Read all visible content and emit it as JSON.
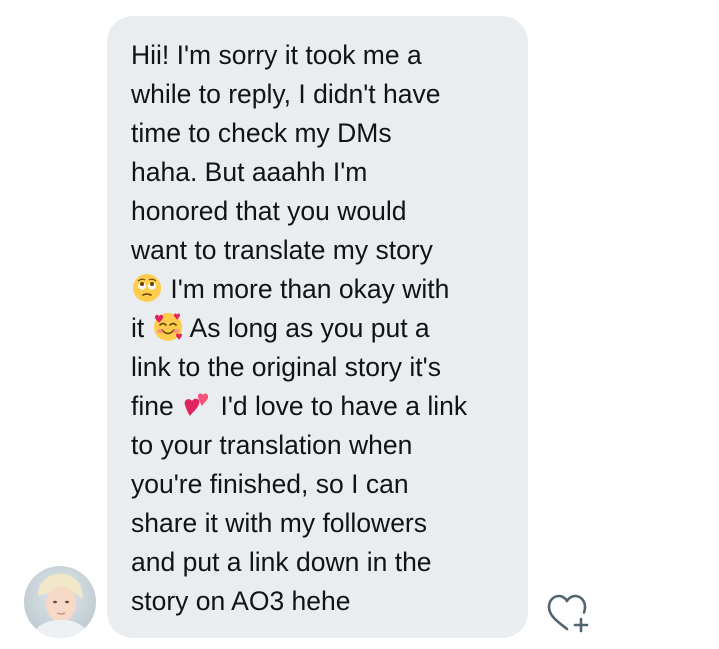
{
  "message": {
    "lines": [
      "Hii! I'm sorry it took me a",
      "while to reply, I didn't have",
      "time to check my DMs",
      "haha. But aaahh I'm",
      "honored that you would",
      "want to translate my story"
    ],
    "line_7_after_emoji": " I'm more than okay with",
    "line_8_before_emoji": "it ",
    "line_8_after_emoji": " As long as you put a",
    "line_9": "link to the original story it's",
    "line_10_before_emoji": "fine ",
    "line_10_after_emoji": " I'd love to have a link",
    "lines_after": [
      "to your translation when",
      "you're finished, so I can",
      "share it with my followers",
      "and put a link down in the",
      "story on AO3 hehe"
    ],
    "emojis": [
      "pleading-rolling-eyes-emoji",
      "smiling-face-with-hearts-emoji",
      "two-hearts-emoji"
    ]
  },
  "colors": {
    "bubble_bg": "#eaedf0",
    "text": "#0f1419",
    "react_icon": "#536471"
  },
  "icons": {
    "react": "heart-plus-icon"
  }
}
